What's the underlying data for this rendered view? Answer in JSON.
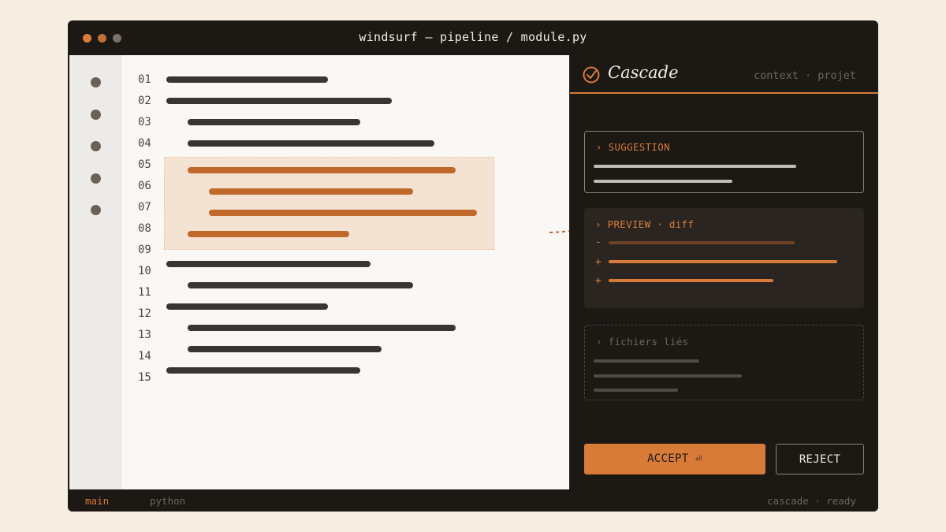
{
  "window": {
    "title": "windsurf — pipeline / module.py"
  },
  "editor": {
    "line_numbers": [
      "01",
      "02",
      "03",
      "04",
      "05",
      "06",
      "07",
      "08",
      "09",
      "10",
      "11",
      "12",
      "13",
      "14",
      "15"
    ],
    "highlighted_lines": [
      "05",
      "06",
      "07",
      "08"
    ]
  },
  "panel": {
    "title": "Cascade",
    "meta": "context · projet",
    "suggestion": {
      "title": "› SUGGESTION"
    },
    "preview": {
      "title": "› PREVIEW · diff",
      "signs": [
        "-",
        "+",
        "+"
      ]
    },
    "files": {
      "title": "› fichiers liés"
    },
    "accept_label": "ACCEPT ⏎",
    "reject_label": "REJECT"
  },
  "status": {
    "branch": "main",
    "language": "python",
    "right": "cascade · ready"
  },
  "colors": {
    "accent": "#d97b38",
    "dark": "#1c1814",
    "highlight": "#c0692a",
    "selection": "#f4e2d3"
  },
  "icons": [
    "check-circle-icon",
    "dashed-arrow-icon"
  ]
}
